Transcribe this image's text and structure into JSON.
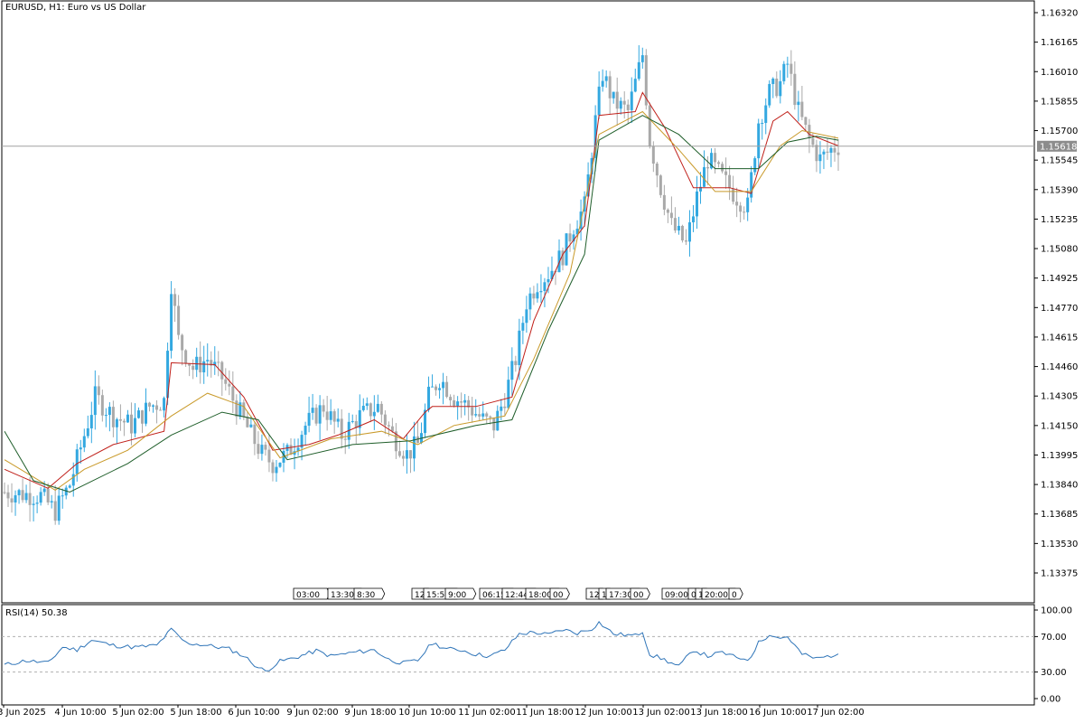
{
  "header": {
    "title": "EURUSD, H1:  Euro vs US Dollar"
  },
  "rsi_panel": {
    "title": "RSI(14) 50.38"
  },
  "current_price_label": "1.15618",
  "colors": {
    "bull": "#33a8e0",
    "bear": "#a9a9a9",
    "ma_fast": "#c0201a",
    "ma_mid": "#c99a2a",
    "ma_slow": "#1f5e2a",
    "rsi": "#2e74b8",
    "price_line": "#a0a0a0",
    "axis": "#000000"
  },
  "chart_data": [
    {
      "type": "candlestick",
      "symbol": "EURUSD",
      "timeframe": "H1",
      "ylim": [
        1.133,
        1.1634
      ],
      "yticks": [
        "1.16320",
        "1.16165",
        "1.16010",
        "1.15855",
        "1.15700",
        "1.15545",
        "1.15390",
        "1.15235",
        "1.15080",
        "1.14925",
        "1.14770",
        "1.14615",
        "1.14460",
        "1.14305",
        "1.14150",
        "1.13995",
        "1.13840",
        "1.13685",
        "1.13530",
        "1.13375"
      ],
      "xticks": [
        "3 Jun 2025",
        "4 Jun 10:00",
        "5 Jun 02:00",
        "5 Jun 18:00",
        "6 Jun 10:00",
        "9 Jun 02:00",
        "9 Jun 18:00",
        "10 Jun 10:00",
        "11 Jun 02:00",
        "11 Jun 18:00",
        "12 Jun 10:00",
        "13 Jun 02:00",
        "13 Jun 18:00",
        "16 Jun 10:00",
        "17 Jun 02:00"
      ],
      "current_price": 1.15618,
      "event_labels": [
        "03:00",
        "13:30",
        "8:30",
        "12",
        "15:56",
        "9:00",
        "06:15",
        "12:44",
        "18:00",
        "00",
        "12",
        "1",
        "17:30",
        "00",
        "09:00",
        "0",
        "1",
        "20:00",
        "0"
      ],
      "close_path": [
        {
          "i": 0,
          "c": 1.138
        },
        {
          "i": 10,
          "c": 1.1378
        },
        {
          "i": 14,
          "c": 1.137
        },
        {
          "i": 18,
          "c": 1.1384
        },
        {
          "i": 22,
          "c": 1.141
        },
        {
          "i": 25,
          "c": 1.143
        },
        {
          "i": 30,
          "c": 1.142
        },
        {
          "i": 35,
          "c": 1.1415
        },
        {
          "i": 40,
          "c": 1.1425
        },
        {
          "i": 44,
          "c": 1.1428
        },
        {
          "i": 46,
          "c": 1.149
        },
        {
          "i": 48,
          "c": 1.146
        },
        {
          "i": 52,
          "c": 1.1445
        },
        {
          "i": 56,
          "c": 1.145
        },
        {
          "i": 60,
          "c": 1.144
        },
        {
          "i": 64,
          "c": 1.1425
        },
        {
          "i": 68,
          "c": 1.141
        },
        {
          "i": 71,
          "c": 1.14
        },
        {
          "i": 74,
          "c": 1.1395
        },
        {
          "i": 78,
          "c": 1.14
        },
        {
          "i": 83,
          "c": 1.1415
        },
        {
          "i": 88,
          "c": 1.1425
        },
        {
          "i": 93,
          "c": 1.141
        },
        {
          "i": 98,
          "c": 1.142
        },
        {
          "i": 103,
          "c": 1.1425
        },
        {
          "i": 107,
          "c": 1.141
        },
        {
          "i": 111,
          "c": 1.14
        },
        {
          "i": 114,
          "c": 1.1405
        },
        {
          "i": 117,
          "c": 1.143
        },
        {
          "i": 120,
          "c": 1.144
        },
        {
          "i": 124,
          "c": 1.143
        },
        {
          "i": 128,
          "c": 1.1425
        },
        {
          "i": 132,
          "c": 1.1418
        },
        {
          "i": 135,
          "c": 1.1415
        },
        {
          "i": 138,
          "c": 1.143
        },
        {
          "i": 141,
          "c": 1.145
        },
        {
          "i": 144,
          "c": 1.148
        },
        {
          "i": 147,
          "c": 1.149
        },
        {
          "i": 150,
          "c": 1.1495
        },
        {
          "i": 154,
          "c": 1.1505
        },
        {
          "i": 157,
          "c": 1.152
        },
        {
          "i": 160,
          "c": 1.153
        },
        {
          "i": 163,
          "c": 1.1575
        },
        {
          "i": 165,
          "c": 1.16
        },
        {
          "i": 168,
          "c": 1.1585
        },
        {
          "i": 172,
          "c": 1.158
        },
        {
          "i": 176,
          "c": 1.161
        },
        {
          "i": 178,
          "c": 1.1565
        },
        {
          "i": 181,
          "c": 1.154
        },
        {
          "i": 184,
          "c": 1.152
        },
        {
          "i": 188,
          "c": 1.151
        },
        {
          "i": 191,
          "c": 1.1535
        },
        {
          "i": 194,
          "c": 1.1555
        },
        {
          "i": 198,
          "c": 1.1545
        },
        {
          "i": 202,
          "c": 1.1535
        },
        {
          "i": 205,
          "c": 1.153
        },
        {
          "i": 208,
          "c": 1.1575
        },
        {
          "i": 211,
          "c": 1.159
        },
        {
          "i": 214,
          "c": 1.1595
        },
        {
          "i": 216,
          "c": 1.1605
        },
        {
          "i": 219,
          "c": 1.158
        },
        {
          "i": 222,
          "c": 1.1565
        },
        {
          "i": 225,
          "c": 1.1555
        },
        {
          "i": 228,
          "c": 1.156
        },
        {
          "i": 230,
          "c": 1.1562
        }
      ],
      "moving_averages": [
        {
          "name": "MA fast",
          "points": [
            {
              "i": 0,
              "v": 1.1392
            },
            {
              "i": 12,
              "v": 1.1382
            },
            {
              "i": 20,
              "v": 1.1395
            },
            {
              "i": 30,
              "v": 1.1405
            },
            {
              "i": 44,
              "v": 1.1412
            },
            {
              "i": 46,
              "v": 1.1448
            },
            {
              "i": 58,
              "v": 1.1447
            },
            {
              "i": 66,
              "v": 1.143
            },
            {
              "i": 74,
              "v": 1.1402
            },
            {
              "i": 84,
              "v": 1.1405
            },
            {
              "i": 92,
              "v": 1.141
            },
            {
              "i": 102,
              "v": 1.1418
            },
            {
              "i": 110,
              "v": 1.1408
            },
            {
              "i": 116,
              "v": 1.1422
            },
            {
              "i": 118,
              "v": 1.1425
            },
            {
              "i": 130,
              "v": 1.1425
            },
            {
              "i": 140,
              "v": 1.143
            },
            {
              "i": 146,
              "v": 1.147
            },
            {
              "i": 154,
              "v": 1.1505
            },
            {
              "i": 160,
              "v": 1.152
            },
            {
              "i": 164,
              "v": 1.1578
            },
            {
              "i": 174,
              "v": 1.158
            },
            {
              "i": 176,
              "v": 1.159
            },
            {
              "i": 182,
              "v": 1.1572
            },
            {
              "i": 190,
              "v": 1.154
            },
            {
              "i": 200,
              "v": 1.154
            },
            {
              "i": 206,
              "v": 1.1537
            },
            {
              "i": 212,
              "v": 1.1575
            },
            {
              "i": 216,
              "v": 1.158
            },
            {
              "i": 222,
              "v": 1.1568
            },
            {
              "i": 230,
              "v": 1.1562
            }
          ]
        },
        {
          "name": "MA mid",
          "points": [
            {
              "i": 0,
              "v": 1.1397
            },
            {
              "i": 14,
              "v": 1.1381
            },
            {
              "i": 22,
              "v": 1.1392
            },
            {
              "i": 34,
              "v": 1.1402
            },
            {
              "i": 46,
              "v": 1.142
            },
            {
              "i": 56,
              "v": 1.1432
            },
            {
              "i": 66,
              "v": 1.1425
            },
            {
              "i": 76,
              "v": 1.1398
            },
            {
              "i": 90,
              "v": 1.1408
            },
            {
              "i": 104,
              "v": 1.1412
            },
            {
              "i": 114,
              "v": 1.1405
            },
            {
              "i": 124,
              "v": 1.1415
            },
            {
              "i": 138,
              "v": 1.142
            },
            {
              "i": 146,
              "v": 1.145
            },
            {
              "i": 156,
              "v": 1.1495
            },
            {
              "i": 164,
              "v": 1.1568
            },
            {
              "i": 176,
              "v": 1.158
            },
            {
              "i": 186,
              "v": 1.156
            },
            {
              "i": 196,
              "v": 1.1538
            },
            {
              "i": 206,
              "v": 1.1538
            },
            {
              "i": 214,
              "v": 1.1562
            },
            {
              "i": 220,
              "v": 1.157
            },
            {
              "i": 230,
              "v": 1.1566
            }
          ]
        },
        {
          "name": "MA slow",
          "points": [
            {
              "i": 0,
              "v": 1.1412
            },
            {
              "i": 8,
              "v": 1.1386
            },
            {
              "i": 18,
              "v": 1.138
            },
            {
              "i": 34,
              "v": 1.1395
            },
            {
              "i": 46,
              "v": 1.141
            },
            {
              "i": 60,
              "v": 1.1422
            },
            {
              "i": 70,
              "v": 1.1418
            },
            {
              "i": 78,
              "v": 1.1397
            },
            {
              "i": 96,
              "v": 1.1405
            },
            {
              "i": 112,
              "v": 1.1407
            },
            {
              "i": 130,
              "v": 1.1415
            },
            {
              "i": 140,
              "v": 1.1418
            },
            {
              "i": 150,
              "v": 1.1465
            },
            {
              "i": 160,
              "v": 1.1505
            },
            {
              "i": 164,
              "v": 1.1565
            },
            {
              "i": 176,
              "v": 1.1578
            },
            {
              "i": 186,
              "v": 1.1568
            },
            {
              "i": 196,
              "v": 1.155
            },
            {
              "i": 208,
              "v": 1.155
            },
            {
              "i": 216,
              "v": 1.1564
            },
            {
              "i": 224,
              "v": 1.1567
            },
            {
              "i": 230,
              "v": 1.1565
            }
          ]
        }
      ]
    },
    {
      "type": "line",
      "name": "RSI(14)",
      "ylim": [
        0,
        100
      ],
      "yticks": [
        "100.00",
        "70.00",
        "30.00",
        "0.00"
      ],
      "levels": [
        70,
        30
      ],
      "points": [
        {
          "i": 0,
          "v": 38
        },
        {
          "i": 6,
          "v": 43
        },
        {
          "i": 12,
          "v": 40
        },
        {
          "i": 16,
          "v": 58
        },
        {
          "i": 20,
          "v": 55
        },
        {
          "i": 24,
          "v": 66
        },
        {
          "i": 30,
          "v": 60
        },
        {
          "i": 36,
          "v": 58
        },
        {
          "i": 42,
          "v": 60
        },
        {
          "i": 46,
          "v": 78
        },
        {
          "i": 50,
          "v": 63
        },
        {
          "i": 56,
          "v": 60
        },
        {
          "i": 62,
          "v": 56
        },
        {
          "i": 66,
          "v": 48
        },
        {
          "i": 70,
          "v": 35
        },
        {
          "i": 72,
          "v": 31
        },
        {
          "i": 76,
          "v": 42
        },
        {
          "i": 80,
          "v": 46
        },
        {
          "i": 86,
          "v": 54
        },
        {
          "i": 90,
          "v": 48
        },
        {
          "i": 96,
          "v": 52
        },
        {
          "i": 102,
          "v": 55
        },
        {
          "i": 106,
          "v": 44
        },
        {
          "i": 110,
          "v": 40
        },
        {
          "i": 114,
          "v": 43
        },
        {
          "i": 118,
          "v": 63
        },
        {
          "i": 122,
          "v": 56
        },
        {
          "i": 126,
          "v": 55
        },
        {
          "i": 130,
          "v": 50
        },
        {
          "i": 134,
          "v": 48
        },
        {
          "i": 138,
          "v": 55
        },
        {
          "i": 142,
          "v": 73
        },
        {
          "i": 146,
          "v": 75
        },
        {
          "i": 150,
          "v": 72
        },
        {
          "i": 154,
          "v": 78
        },
        {
          "i": 158,
          "v": 74
        },
        {
          "i": 162,
          "v": 79
        },
        {
          "i": 164,
          "v": 86
        },
        {
          "i": 168,
          "v": 73
        },
        {
          "i": 174,
          "v": 71
        },
        {
          "i": 176,
          "v": 76
        },
        {
          "i": 178,
          "v": 50
        },
        {
          "i": 182,
          "v": 44
        },
        {
          "i": 186,
          "v": 36
        },
        {
          "i": 190,
          "v": 55
        },
        {
          "i": 194,
          "v": 48
        },
        {
          "i": 198,
          "v": 52
        },
        {
          "i": 202,
          "v": 46
        },
        {
          "i": 206,
          "v": 45
        },
        {
          "i": 208,
          "v": 66
        },
        {
          "i": 212,
          "v": 72
        },
        {
          "i": 214,
          "v": 68
        },
        {
          "i": 216,
          "v": 70
        },
        {
          "i": 220,
          "v": 50
        },
        {
          "i": 224,
          "v": 45
        },
        {
          "i": 230,
          "v": 50.38
        }
      ]
    }
  ]
}
